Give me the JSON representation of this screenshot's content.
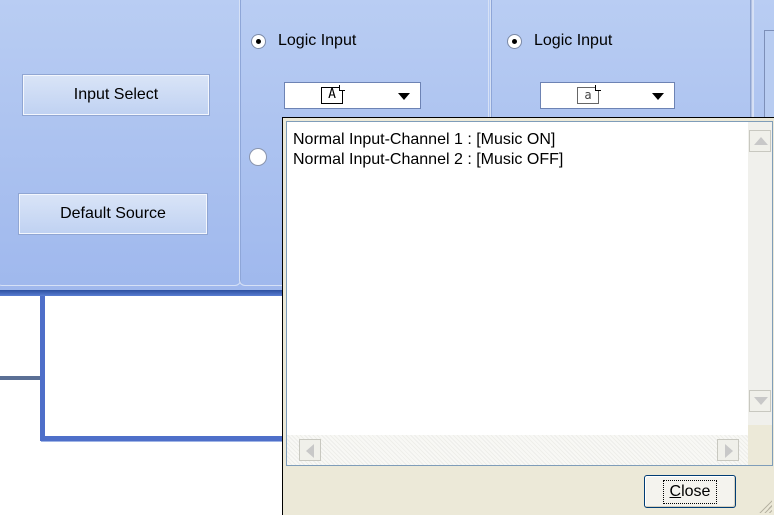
{
  "panel": {
    "input_select_label": "Input Select",
    "default_source_label": "Default Source",
    "radio_a_label": "Logic Input",
    "radio_b_label": "Logic Input",
    "combo_a_glyph": "A",
    "combo_b_glyph": "a"
  },
  "popup": {
    "items": [
      "Normal Input-Channel 1 : [Music ON]",
      "Normal Input-Channel 2 : [Music OFF]"
    ],
    "close_label": "Close"
  },
  "icons": {
    "radio_checked": "radio-dot",
    "combo_arrow": "chevron-down-icon",
    "scroll_up": "scroll-up-icon",
    "scroll_down": "scroll-down-icon",
    "scroll_left": "scroll-left-icon",
    "scroll_right": "scroll-right-icon",
    "grip": "resize-grip-icon"
  },
  "colors": {
    "panel": "#a9c0ef",
    "accent": "#4e6fc9",
    "popup_bg": "#ece9d8"
  }
}
